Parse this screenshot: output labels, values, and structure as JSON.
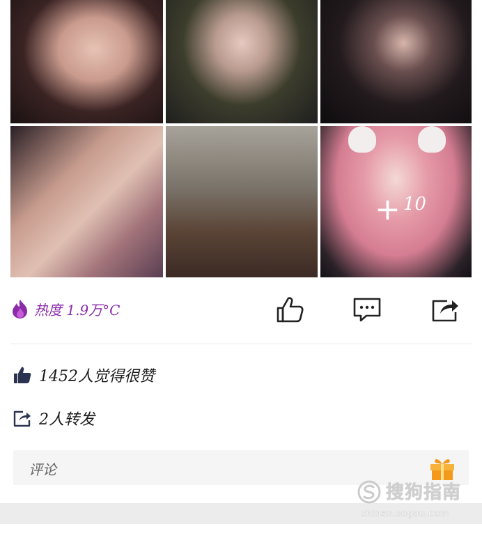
{
  "post": {
    "photos": [
      {
        "alt": "photo-1"
      },
      {
        "alt": "photo-2"
      },
      {
        "alt": "photo-3"
      },
      {
        "alt": "photo-4"
      },
      {
        "alt": "photo-5"
      },
      {
        "alt": "photo-6"
      }
    ],
    "more_photos_overlay": {
      "plus": "+",
      "count": "10"
    }
  },
  "actions": {
    "heat_text": "热度 1.9万°C",
    "like_icon": "thumbs-up-outline-icon",
    "comment_icon": "comment-bubble-icon",
    "share_icon": "share-icon"
  },
  "stats": {
    "likes_text": "1452人觉得很赞",
    "shares_text": "2人转发"
  },
  "comment_box": {
    "placeholder": "评论"
  },
  "watermark": {
    "title": "搜狗指南",
    "url": "zhinan.sogou.com"
  },
  "colors": {
    "heat_purple": "#8a2ca8",
    "icon_dark": "#222222",
    "stat_icon_blue": "#2b3350",
    "comment_bg": "#f5f5f5",
    "gift_orange": "#f39a1c"
  }
}
